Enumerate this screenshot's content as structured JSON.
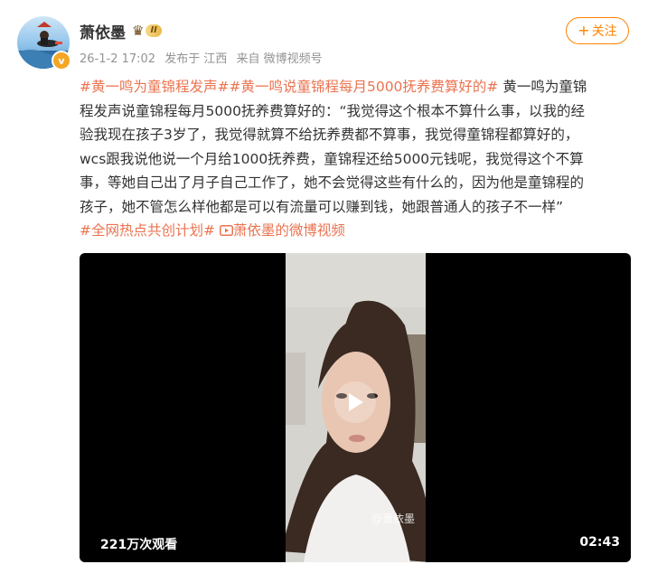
{
  "post": {
    "username": "萧依墨",
    "vip_level": "II",
    "verified_mark": "v",
    "timestamp": "26-1-2 17:02",
    "location": "发布于 江西",
    "source": "来自 微博视频号",
    "follow_label": "关注",
    "follow_plus": "+"
  },
  "content": {
    "line1": {
      "tag1": "#黄一鸣为童锦程发声#",
      "tag2": "#黄一鸣说童锦程每月5000抚养费算好的#",
      "text": " 黄一鸣为童锦"
    },
    "line2": "程发声说童锦程每月5000抚养费算好的：“我觉得这个根本不算什么事，以我的经",
    "line3": "验我现在孩子3岁了，我觉得就算不给抚养费都不算事，我觉得童锦程都算好的，",
    "line4": "wcs跟我说他说一个月给1000抚养费，童锦程还给5000元钱呢，我觉得这个不算",
    "line5": "事，等她自己出了月子自己工作了，她不会觉得这些有什么的，因为他是童锦程的",
    "line6": "孩子，她不管怎么样他都是可以有流量可以赚到钱，她跟普通人的孩子不一样”",
    "line7": {
      "tag": "#全网热点共创计划#",
      "video_link": "萧依墨的微博视频"
    }
  },
  "video": {
    "views": "221万次观看",
    "duration": "02:43",
    "watermark": "@萧依墨"
  },
  "colors": {
    "tag": "#eb7350",
    "follow": "#ff8200",
    "meta": "#939393"
  }
}
